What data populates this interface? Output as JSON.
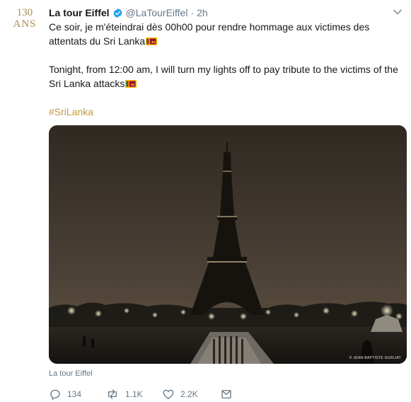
{
  "avatar": {
    "number": "130",
    "label": "ANS"
  },
  "tweet": {
    "display_name": "La tour Eiffel",
    "handle": "@LaTourEiffel",
    "separator": "·",
    "time": "2h",
    "text_fr": "Ce soir, je m'éteindrai dès 00h00 pour rendre hommage aux victimes des attentats du Sri Lanka",
    "text_en": "Tonight, from 12:00 am, I will turn my lights off to pay tribute to the victims of the Sri Lanka attacks",
    "hashtag": "#SriLanka",
    "photo_credit": "© JEAN-BAPTISTE GURLIAT",
    "source": "La tour Eiffel"
  },
  "actions": {
    "replies": "134",
    "retweets": "1.1K",
    "likes": "2.2K"
  },
  "colors": {
    "verified": "#1da1f2",
    "hashtag": "#c49a45",
    "avatar_gold": "#b08a55",
    "muted": "#657786"
  },
  "icons": [
    "verified-badge-icon",
    "chevron-down-icon",
    "sri-lanka-flag-icon",
    "reply-icon",
    "retweet-icon",
    "like-icon",
    "message-icon"
  ]
}
